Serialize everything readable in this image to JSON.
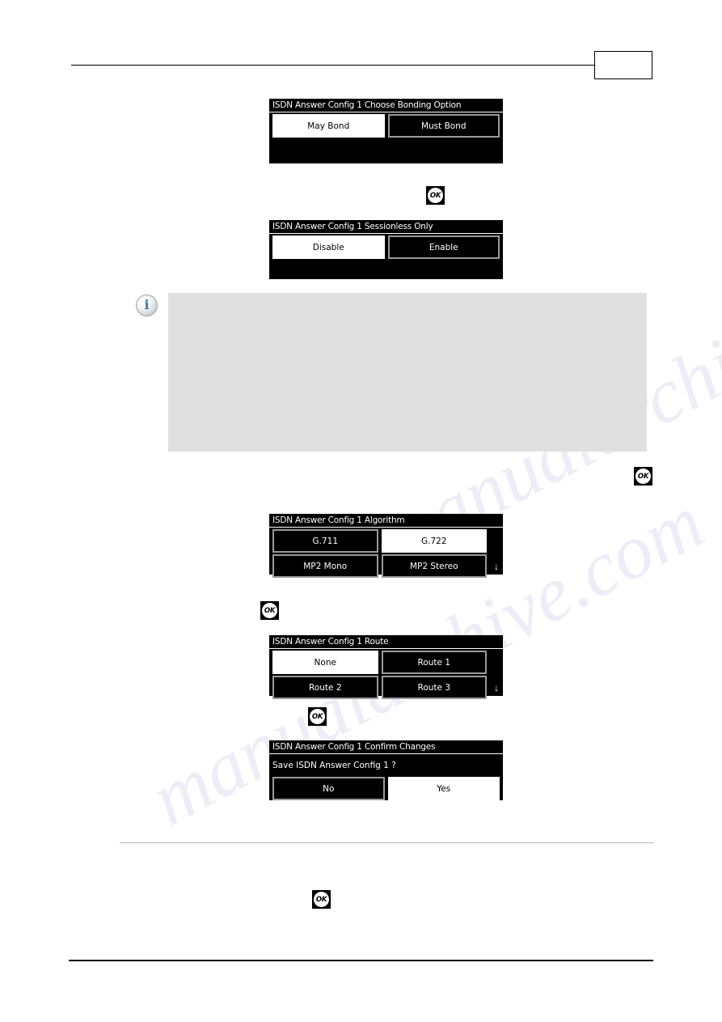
{
  "header": {
    "page_box_label": ""
  },
  "screens": [
    {
      "id": "bonding",
      "title": "ISDN Answer Config 1 Choose Bonding Option",
      "options": [
        {
          "label": "May Bond",
          "selected": true
        },
        {
          "label": "Must Bond",
          "selected": false
        }
      ],
      "scroll_arrow": ""
    },
    {
      "id": "sessionless",
      "title": "ISDN Answer Config 1 Sessionless Only",
      "options": [
        {
          "label": "Disable",
          "selected": true
        },
        {
          "label": "Enable",
          "selected": false
        }
      ],
      "scroll_arrow": ""
    },
    {
      "id": "algorithm",
      "title": "ISDN Answer Config 1 Algorithm",
      "options": [
        {
          "label": "G.711",
          "selected": false
        },
        {
          "label": "G.722",
          "selected": true
        },
        {
          "label": "MP2 Mono",
          "selected": false
        },
        {
          "label": "MP2 Stereo",
          "selected": false
        }
      ],
      "scroll_arrow": "↓"
    },
    {
      "id": "route",
      "title": "ISDN Answer Config 1 Route",
      "options": [
        {
          "label": "None",
          "selected": true
        },
        {
          "label": "Route 1",
          "selected": false
        },
        {
          "label": "Route 2",
          "selected": false
        },
        {
          "label": "Route 3",
          "selected": false
        }
      ],
      "scroll_arrow": "↓"
    },
    {
      "id": "confirm",
      "title": "ISDN Answer Config 1 Confirm Changes",
      "prompt": "Save ISDN Answer Config 1 ?",
      "options": [
        {
          "label": "No",
          "selected": false
        },
        {
          "label": "Yes",
          "selected": true
        }
      ],
      "scroll_arrow": ""
    }
  ],
  "ok_keys": [
    {
      "label": "OK"
    },
    {
      "label": "OK"
    },
    {
      "label": "OK"
    },
    {
      "label": "OK"
    },
    {
      "label": "OK"
    }
  ],
  "note": {
    "icon": "info-icon",
    "text": ""
  },
  "watermark": {
    "line_a": "manualarchive.com",
    "line_b": "manualarchive.com"
  },
  "colors": {
    "screen_bg": "#000000",
    "screen_fg": "#ffffff",
    "option_border": "#9a9a9a",
    "note_bg": "#e0e0e0",
    "info_blue": "#3d7aa8"
  }
}
